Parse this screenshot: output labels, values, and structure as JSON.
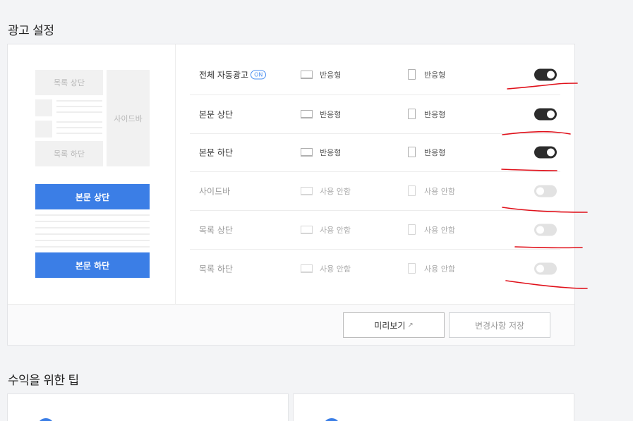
{
  "page": {
    "section_title": "광고 설정",
    "tips_title": "수익을 위한 팁"
  },
  "preview": {
    "list_top": "목록 상단",
    "list_bottom": "목록 하단",
    "sidebar": "사이드바",
    "body_top": "본문 상단",
    "body_bottom": "본문 하단"
  },
  "settings": {
    "on_badge": "ON",
    "rows": [
      {
        "label": "전체 자동광고",
        "pc": "반응형",
        "mobile": "반응형",
        "enabled": true
      },
      {
        "label": "본문 상단",
        "pc": "반응형",
        "mobile": "반응형",
        "enabled": true
      },
      {
        "label": "본문 하단",
        "pc": "반응형",
        "mobile": "반응형",
        "enabled": true
      },
      {
        "label": "사이드바",
        "pc": "사용 안함",
        "mobile": "사용 안함",
        "enabled": false
      },
      {
        "label": "목록 상단",
        "pc": "사용 안함",
        "mobile": "사용 안함",
        "enabled": false
      },
      {
        "label": "목록 하단",
        "pc": "사용 안함",
        "mobile": "사용 안함",
        "enabled": false
      }
    ]
  },
  "footer": {
    "preview_label": "미리보기",
    "save_label": "변경사항 저장"
  },
  "icons": {
    "pc": "monitor-icon",
    "mobile": "smartphone-icon",
    "external": "external-link-icon"
  },
  "colors": {
    "accent": "#3b7ee6",
    "toggle_on": "#2c2c2c",
    "toggle_off": "#e2e2e2",
    "annotation": "#e0101a"
  }
}
